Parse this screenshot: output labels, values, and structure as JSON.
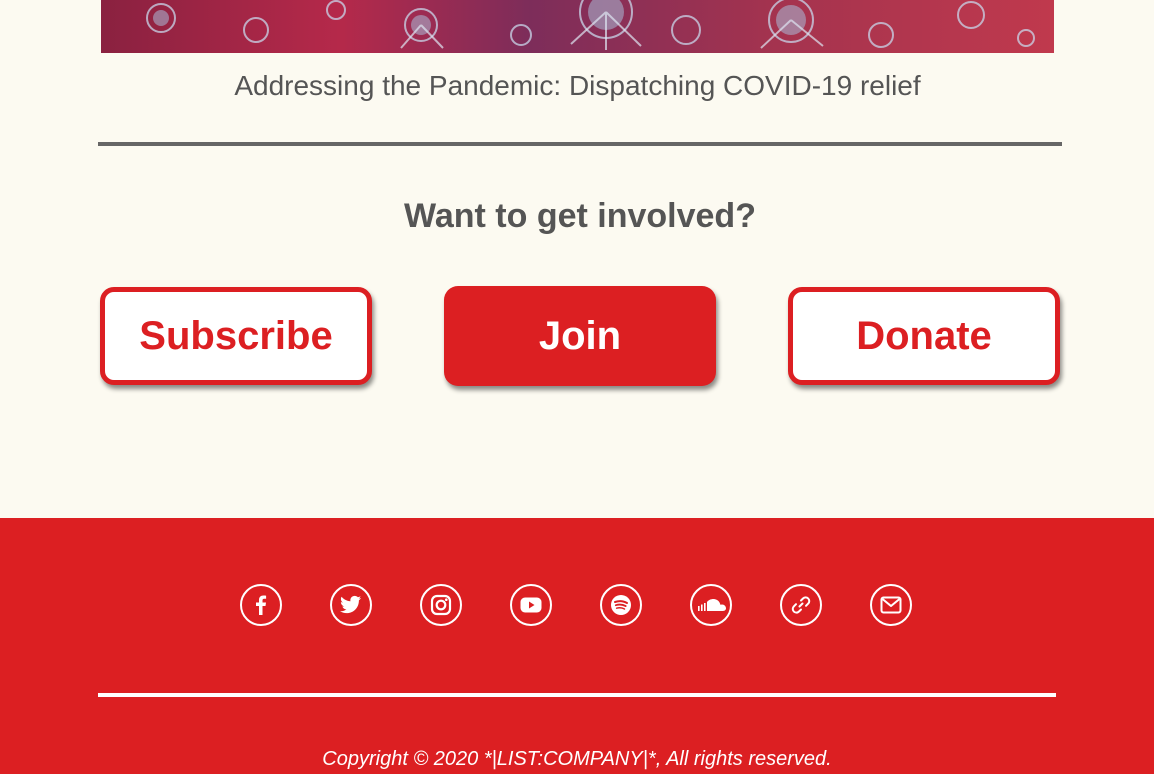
{
  "article": {
    "caption": "Addressing the Pandemic: Dispatching COVID-19 relief"
  },
  "involved": {
    "title": "Want to get involved?",
    "buttons": {
      "subscribe": "Subscribe",
      "join": "Join",
      "donate": "Donate"
    }
  },
  "footer": {
    "social_icons": [
      "facebook-icon",
      "twitter-icon",
      "instagram-icon",
      "youtube-icon",
      "spotify-icon",
      "soundcloud-icon",
      "link-icon",
      "email-icon"
    ],
    "copyright": "Copyright © 2020 *|LIST:COMPANY|*, All rights reserved."
  },
  "colors": {
    "brand_red": "#dc1f22",
    "background": "#fcfaf1",
    "text_gray": "#555555"
  }
}
